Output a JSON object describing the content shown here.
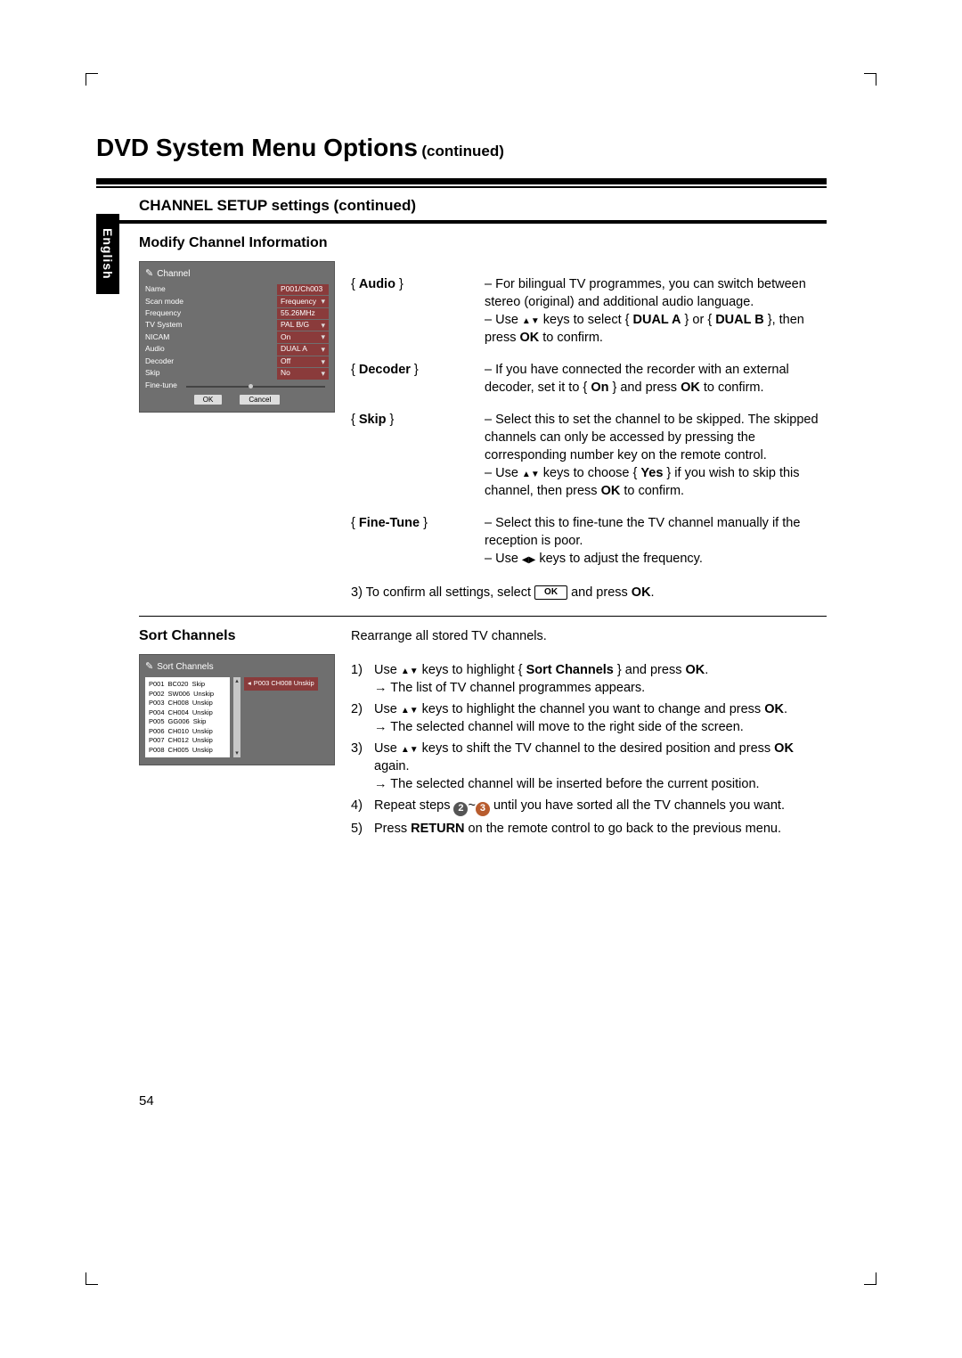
{
  "lang_tab": "English",
  "page_number": "54",
  "title_main": "DVD System Menu Options",
  "title_cont": "(continued)",
  "section_header": "CHANNEL SETUP settings (continued)",
  "modify": {
    "heading": "Modify Channel Information",
    "osd": {
      "title": "Channel",
      "rows": [
        {
          "label": "Name",
          "value": "P001/Ch003",
          "dd": false
        },
        {
          "label": "Scan mode",
          "value": "Frequency",
          "dd": true
        },
        {
          "label": "Frequency",
          "value": "55.26MHz",
          "dd": false
        },
        {
          "label": "TV System",
          "value": "PAL B/G",
          "dd": true
        },
        {
          "label": "NICAM",
          "value": "On",
          "dd": true
        },
        {
          "label": "Audio",
          "value": "DUAL A",
          "dd": true
        },
        {
          "label": "Decoder",
          "value": "Off",
          "dd": true
        },
        {
          "label": "Skip",
          "value": "No",
          "dd": true
        }
      ],
      "fine_label": "Fine-tune",
      "ok": "OK",
      "cancel": "Cancel"
    },
    "defs": {
      "audio": {
        "term": "{ Audio }",
        "l1": "– For bilingual TV programmes, you can switch between stereo (original) and additional audio language.",
        "l2a": "– Use ",
        "l2b": " keys to select { ",
        "l2c": "DUAL A",
        "l2d": " } or { ",
        "l2e": "DUAL B",
        "l2f": " }, then press ",
        "l2g": "OK",
        "l2h": " to confirm."
      },
      "decoder": {
        "term": "{ Decoder }",
        "l1a": "– If you have connected the recorder with an external decoder, set it to { ",
        "l1b": "On",
        "l1c": " } and press ",
        "l1d": "OK",
        "l1e": " to confirm."
      },
      "skip": {
        "term": "{ Skip }",
        "l1": "– Select this to set the channel to be skipped. The skipped channels can only be accessed by pressing the corresponding number key on the remote control.",
        "l2a": "– Use ",
        "l2b": " keys to choose { ",
        "l2c": "Yes",
        "l2d": " } if you wish to skip this channel, then press ",
        "l2e": "OK",
        "l2f": " to confirm."
      },
      "fine": {
        "term": "{ Fine-Tune }",
        "l1": "–  Select this to fine-tune the TV channel manually if the reception is poor.",
        "l2a": "– Use ",
        "l2b": " keys to adjust the frequency."
      }
    },
    "confirm": {
      "pre": "3)  To confirm all settings, select ",
      "mid": " and press ",
      "ok": "OK",
      "post": "."
    }
  },
  "sort": {
    "heading": "Sort Channels",
    "intro": "Rearrange all stored TV channels.",
    "osd": {
      "title": "Sort Channels",
      "rows": [
        [
          "P001",
          "BC020",
          "Skip"
        ],
        [
          "P002",
          "SW006",
          "Unskip"
        ],
        [
          "P003",
          "CH008",
          "Unskip"
        ],
        [
          "P004",
          "CH004",
          "Unskip"
        ],
        [
          "P005",
          "GG006",
          "Skip"
        ],
        [
          "P006",
          "CH010",
          "Unskip"
        ],
        [
          "P007",
          "CH012",
          "Unskip"
        ],
        [
          "P008",
          "CH005",
          "Unskip"
        ]
      ],
      "moved": "P003   CH008   Unskip"
    },
    "steps": {
      "s1a": "Use ",
      "s1b": " keys to highlight  { ",
      "s1c": "Sort Channels",
      "s1d": " } and press ",
      "s1e": "OK",
      "s1f": ".",
      "s1g": " The list of TV channel programmes appears.",
      "s2a": "Use ",
      "s2b": " keys to highlight the channel you want to change and press ",
      "s2c": "OK",
      "s2d": ".",
      "s2e": " The selected channel will move to the right side of the screen.",
      "s3a": "Use ",
      "s3b": " keys to shift the TV channel to the desired position and press ",
      "s3c": "OK",
      "s3d": " again.",
      "s3e": " The selected channel will be inserted before the current position.",
      "s4a": "Repeat steps ",
      "s4b": "2",
      "s4c": "~",
      "s4d": "3",
      "s4e": " until you have sorted all the TV channels you want.",
      "s5a": "Press ",
      "s5b": "RETURN",
      "s5c": " on the remote control to go back to the previous menu."
    }
  }
}
